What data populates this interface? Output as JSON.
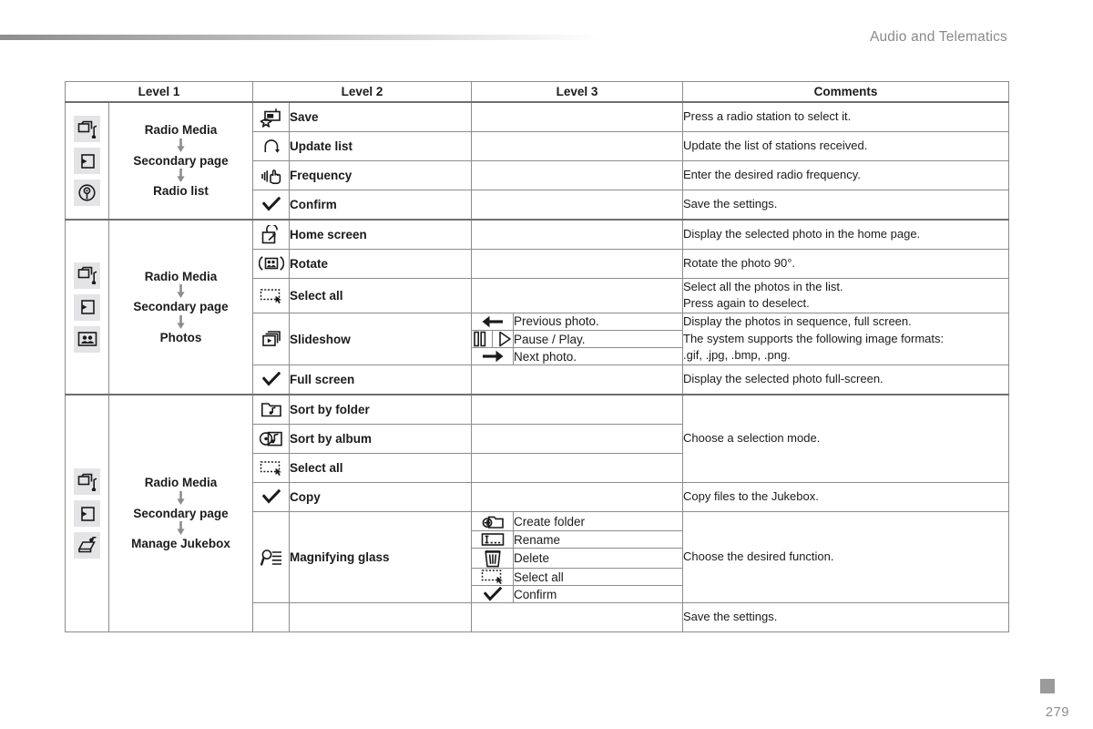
{
  "header": {
    "title": "Audio and Telematics"
  },
  "footer": {
    "page_number": "279"
  },
  "table": {
    "columns": [
      "Level 1",
      "Level 2",
      "Level 3",
      "Comments"
    ],
    "sections": [
      {
        "id": "radio-list",
        "level1_icons": [
          "media-stack-note-icon",
          "enter-arrow-icon",
          "radio-antenna-icon"
        ],
        "path": [
          "Radio Media",
          "Secondary page",
          "Radio list"
        ],
        "rows": [
          {
            "l2_icon": "radio-star-icon",
            "l2_label": "Save",
            "l3": [],
            "comment": "Press a radio station to select it."
          },
          {
            "l2_icon": "refresh-loop-icon",
            "l2_label": "Update list",
            "l3": [],
            "comment": "Update the list of stations received."
          },
          {
            "l2_icon": "hand-tune-icon",
            "l2_label": "Frequency",
            "l3": [],
            "comment": "Enter the desired radio frequency."
          },
          {
            "l2_icon": "check-icon",
            "l2_label": "Confirm",
            "l3": [],
            "comment": "Save the settings."
          }
        ]
      },
      {
        "id": "photos",
        "level1_icons": [
          "media-stack-note-icon",
          "enter-arrow-icon",
          "photo-people-icon"
        ],
        "path": [
          "Radio Media",
          "Secondary page",
          "Photos"
        ],
        "rows": [
          {
            "l2_icon": "home-screen-icon",
            "l2_label": "Home screen",
            "l3": [],
            "comment": "Display the selected photo in the home page."
          },
          {
            "l2_icon": "rotate-photo-icon",
            "l2_label": "Rotate",
            "l3": [],
            "comment": "Rotate the photo 90°."
          },
          {
            "l2_icon": "select-all-icon",
            "l2_label": "Select all",
            "l3": [],
            "comment": "Select all the photos in the list.\nPress again to deselect."
          },
          {
            "l2_icon": "slideshow-icon",
            "l2_label": "Slideshow",
            "l3": [
              {
                "icon": "arrow-left-icon",
                "label": "Previous photo."
              },
              {
                "icon": "pause-play-icon",
                "label": "Pause / Play."
              },
              {
                "icon": "arrow-right-icon",
                "label": "Next photo."
              }
            ],
            "comment": "Display the photos in sequence, full screen.\nThe system supports the following image formats:\n.gif, .jpg, .bmp, .png."
          },
          {
            "l2_icon": "check-icon",
            "l2_label": "Full screen",
            "l3": [],
            "comment": "Display the selected photo full-screen."
          }
        ]
      },
      {
        "id": "manage-jukebox",
        "level1_icons": [
          "media-stack-note-icon",
          "enter-arrow-icon",
          "jukebox-icon"
        ],
        "path": [
          "Radio Media",
          "Secondary page",
          "Manage Jukebox"
        ],
        "rows": [
          {
            "l2_icon": "folder-note-icon",
            "l2_label": "Sort by folder",
            "l3": [],
            "comment": "Choose a selection mode."
          },
          {
            "l2_icon": "album-note-icon",
            "l2_label": "Sort by album",
            "l3": [],
            "comment": ""
          },
          {
            "l2_icon": "select-all-icon",
            "l2_label": "Select all",
            "l3": [],
            "comment": ""
          },
          {
            "l2_icon": "check-icon",
            "l2_label": "Copy",
            "l3": [],
            "comment": "Copy files to the Jukebox."
          },
          {
            "l2_icon": "magnifier-list-icon",
            "l2_label": "Magnifying glass",
            "l3": [
              {
                "icon": "create-folder-icon",
                "label": "Create folder"
              },
              {
                "icon": "rename-icon",
                "label": "Rename"
              },
              {
                "icon": "trash-icon",
                "label": "Delete"
              },
              {
                "icon": "select-all-icon",
                "label": "Select all"
              },
              {
                "icon": "check-icon",
                "label": "Confirm"
              }
            ],
            "comment": "Choose the desired function."
          },
          {
            "l2_icon": "",
            "l2_label": "",
            "l3": [],
            "comment": "Save the settings."
          }
        ]
      }
    ]
  },
  "colors": {
    "header_text": "#8a8a8a",
    "border": "#8c8c8c",
    "thead_bg": "#ececee",
    "comment_bg": "#f1f2f4",
    "icon_chip_bg": "#e4e4e6"
  }
}
